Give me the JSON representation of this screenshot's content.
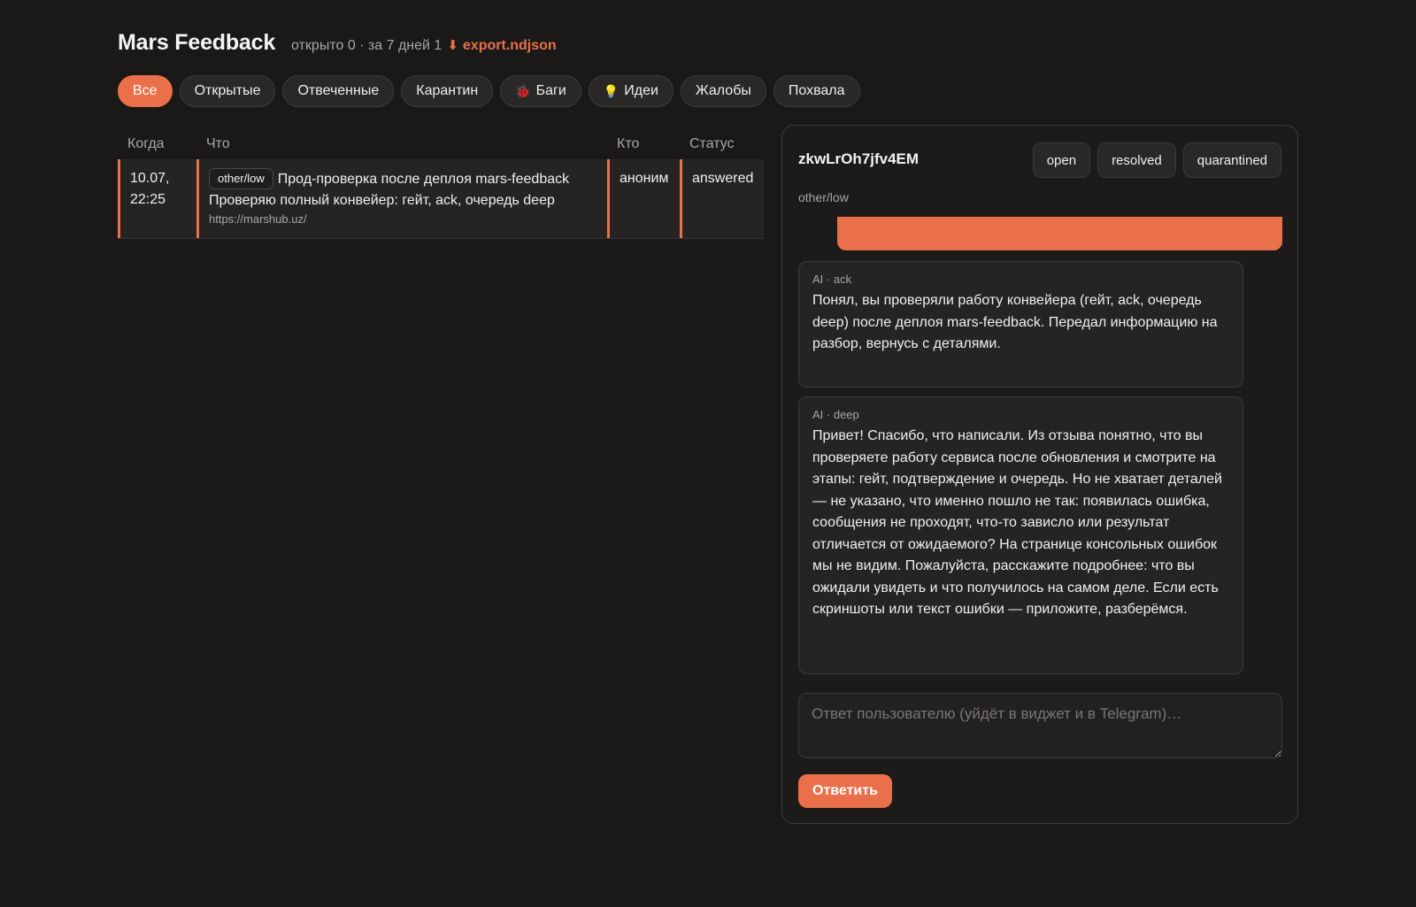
{
  "header": {
    "title": "Mars Feedback",
    "stats": "открыто 0 · за 7 дней 1",
    "export_label": "export.ndjson",
    "export_icon": "download-arrow-icon"
  },
  "filters": [
    {
      "label": "Все",
      "active": true
    },
    {
      "label": "Открытые"
    },
    {
      "label": "Отвеченные"
    },
    {
      "label": "Карантин"
    },
    {
      "label": "Баги",
      "icon": "🐞"
    },
    {
      "label": "Идеи",
      "icon": "💡"
    },
    {
      "label": "Жалобы"
    },
    {
      "label": "Похвала"
    }
  ],
  "table": {
    "columns": [
      "Когда",
      "Что",
      "Кто",
      "Статус"
    ],
    "rows": [
      {
        "when": "10.07,\n22:25",
        "tag": "other/low",
        "title": "Прод-проверка после деплоя mars-feedback",
        "body": "Проверяю полный конвейер: гейт, ack, очередь deep",
        "url": "https://marshub.uz/",
        "who": "аноним",
        "status": "answered"
      }
    ]
  },
  "detail": {
    "id": "zkwLrOh7jfv4EM",
    "category": "other/low",
    "status_buttons": [
      "open",
      "resolved",
      "quarantined"
    ],
    "messages": [
      {
        "label": "AI · ack",
        "text": "Понял, вы проверяли работу конвейера (гейт, ack, очередь deep) после деплоя mars-feedback. Передал информацию на разбор, вернусь с деталями."
      },
      {
        "label": "AI · deep",
        "text": "Привет! Спасибо, что написали. Из отзыва понятно, что вы проверяете работу сервиса после обновления и смотрите на этапы: гейт, подтверждение и очередь. Но не хватает деталей — не указано, что именно пошло не так: появилась ошибка, сообщения не проходят, что-то зависло или результат отличается от ожидаемого? На странице консольных ошибок мы не видим. Пожалуйста, расскажите подробнее: что вы ожидали увидеть и что получилось на самом деле. Если есть скриншоты или текст ошибки — приложите, разберёмся."
      }
    ],
    "reply_placeholder": "Ответ пользователю (уйдёт в виджет и в Telegram)…",
    "reply_value": "",
    "send_label": "Ответить"
  },
  "colors": {
    "accent": "#e9704a",
    "background": "#1a1918",
    "panel": "#262423"
  }
}
